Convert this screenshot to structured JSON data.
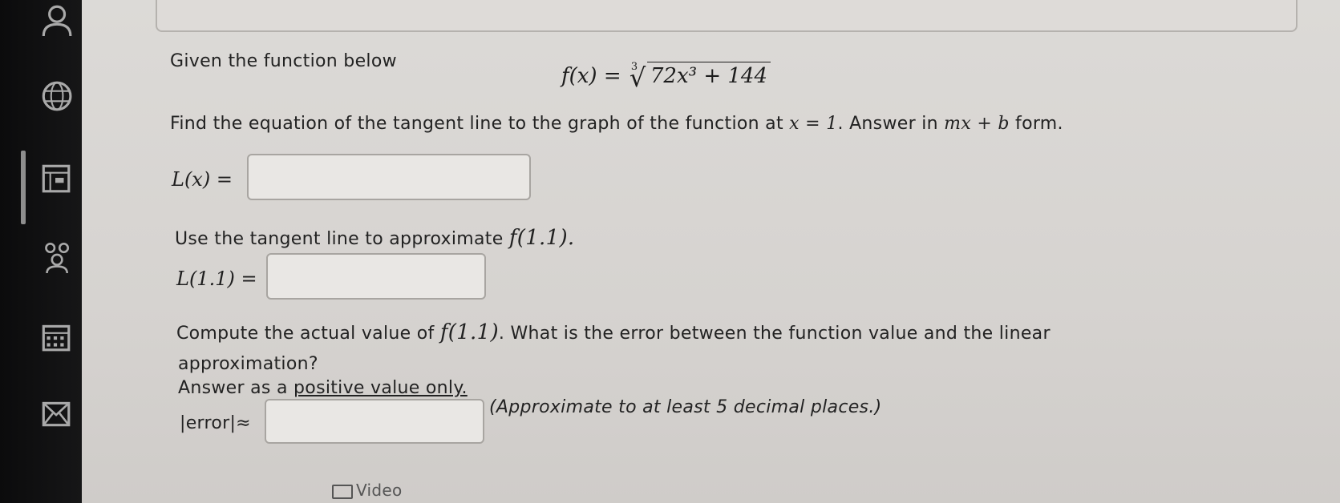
{
  "sidebar": {
    "icons": [
      "person-icon",
      "globe-icon",
      "gradebook-icon",
      "group-icon",
      "calendar-icon",
      "mail-icon"
    ]
  },
  "problem": {
    "intro": "Given the function below",
    "formula_lhs": "f(x) = ",
    "formula_root_index": "3",
    "formula_radicand": "72x³ + 144",
    "q1_text_a": "Find the equation of the tangent line to the graph of the function at ",
    "q1_math_x1": "x = 1",
    "q1_text_b": ". Answer in ",
    "q1_math_form": "mx + b",
    "q1_text_c": " form.",
    "q1_label": "L(x) =",
    "q1_input_value": "",
    "q2_text": "Use the tangent line to approximate ",
    "q2_math": "f(1.1).",
    "q2_label": "L(1.1) =",
    "q2_input_value": "",
    "q3_text_a": "Compute the actual value of ",
    "q3_math": "f(1.1)",
    "q3_text_b": ". What is the error between the function value and the linear",
    "q3_text_c": "approximation?",
    "q3_text_d_pre": "Answer as a ",
    "q3_text_d_under": "positive value only.",
    "q3_label": "|error|≈",
    "q3_input_value": "",
    "q3_note": "(Approximate to at least 5 decimal places.)",
    "video_partial": "Video"
  }
}
